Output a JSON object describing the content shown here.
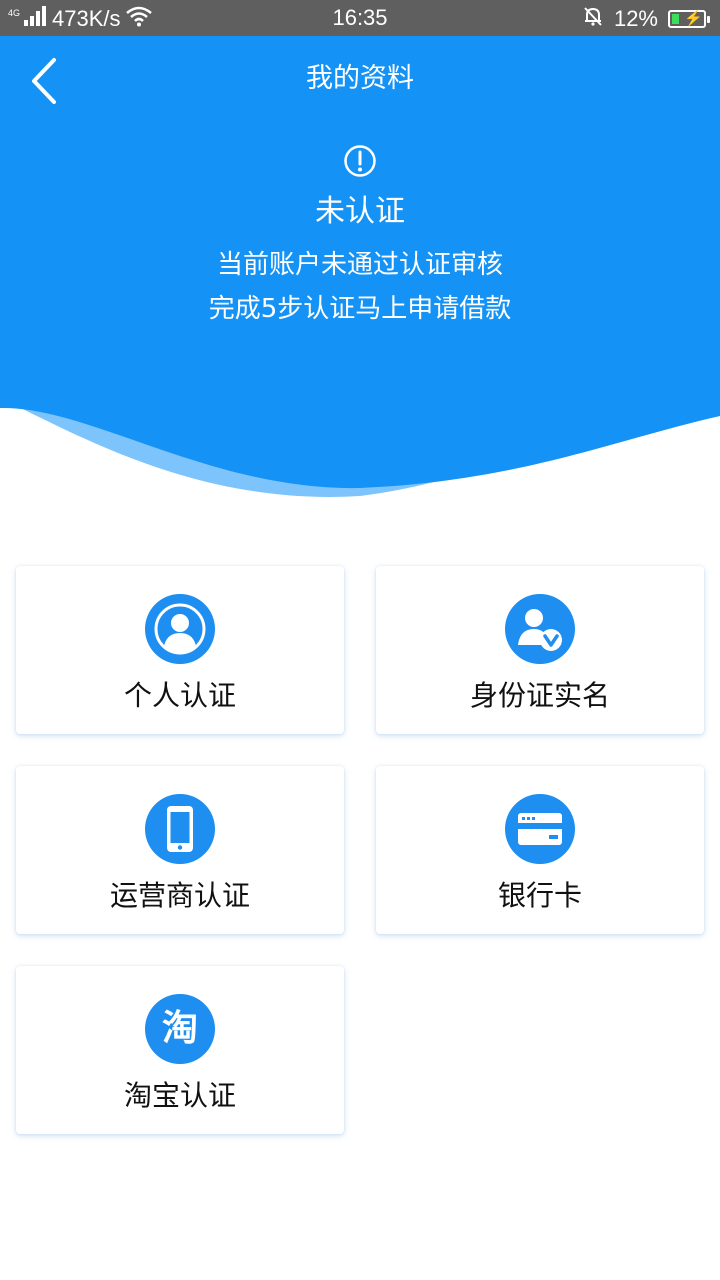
{
  "status_bar": {
    "network_type": "4G",
    "speed": "473K/s",
    "time": "16:35",
    "battery": "12%"
  },
  "header": {
    "title": "我的资料",
    "status_title": "未认证",
    "desc_line1": "当前账户未通过认证审核",
    "desc_line2": "完成5步认证马上申请借款"
  },
  "cards": [
    {
      "label": "个人认证",
      "icon": "person-icon"
    },
    {
      "label": "身份证实名",
      "icon": "verified-user-icon"
    },
    {
      "label": "运营商认证",
      "icon": "phone-icon"
    },
    {
      "label": "银行卡",
      "icon": "bank-card-icon"
    },
    {
      "label": "淘宝认证",
      "icon": "taobao-icon",
      "icon_text": "淘"
    }
  ],
  "colors": {
    "header_blue": "#1592f5",
    "icon_blue": "#1e8ef0",
    "wave_light": "#7cc4fb"
  }
}
